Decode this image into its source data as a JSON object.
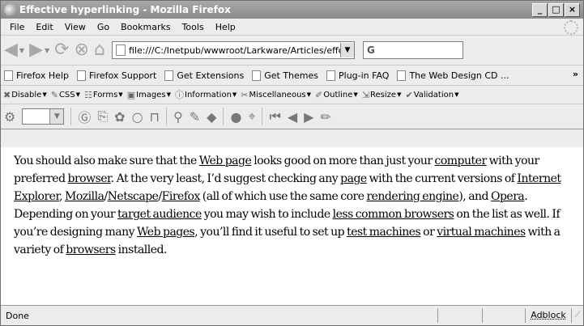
{
  "window": {
    "title": "Effective hyperlinking - Mozilla Firefox"
  },
  "menu": [
    "File",
    "Edit",
    "View",
    "Go",
    "Bookmarks",
    "Tools",
    "Help"
  ],
  "nav": {
    "url": "file:///C:/Inetpub/wwwroot/Larkware/Articles/effectiv",
    "search_glyph": "G"
  },
  "bookmarks": [
    "Firefox Help",
    "Firefox Support",
    "Get Extensions",
    "Get Themes",
    "Plug-in FAQ",
    "The Web Design CD ..."
  ],
  "bookmarks_more": "»",
  "devbar": [
    "Disable",
    "CSS",
    "Forms",
    "Images",
    "Information",
    "Miscellaneous",
    "Outline",
    "Resize",
    "Validation"
  ],
  "content": {
    "t1": "You should also make sure that the ",
    "l_webpage": "Web page",
    "t2": " looks good on more than just your ",
    "l_computer": "computer",
    "t3": " with your preferred ",
    "l_browser": "browser",
    "t4": ". At the very least, I’d suggest checking any ",
    "l_page": "page",
    "t5": " with the current versions of ",
    "l_ie": "Internet Explorer",
    "s1": ", ",
    "l_mozilla": "Mozilla",
    "sl1": "/",
    "l_netscape": "Netscape",
    "sl2": "/",
    "l_firefox": "Firefox",
    "t6": " (all of which use the same core ",
    "l_engine": "rendering engine",
    "t7": "), and ",
    "l_opera": "Opera",
    "t8": ". Depending on your ",
    "l_audience": "target audience",
    "t9": " you may wish to include ",
    "l_less": "less common browsers",
    "t10": " on the list as well. If you’re designing many ",
    "l_webpages": "Web pages",
    "t11": ", you’ll find it useful to set up ",
    "l_test": "test machines",
    "t12": " or ",
    "l_virtual": "virtual machines",
    "t13": " with a variety of ",
    "l_browsers": "browsers",
    "t14": " installed."
  },
  "status": {
    "text": "Done",
    "adblock": "Adblock"
  }
}
